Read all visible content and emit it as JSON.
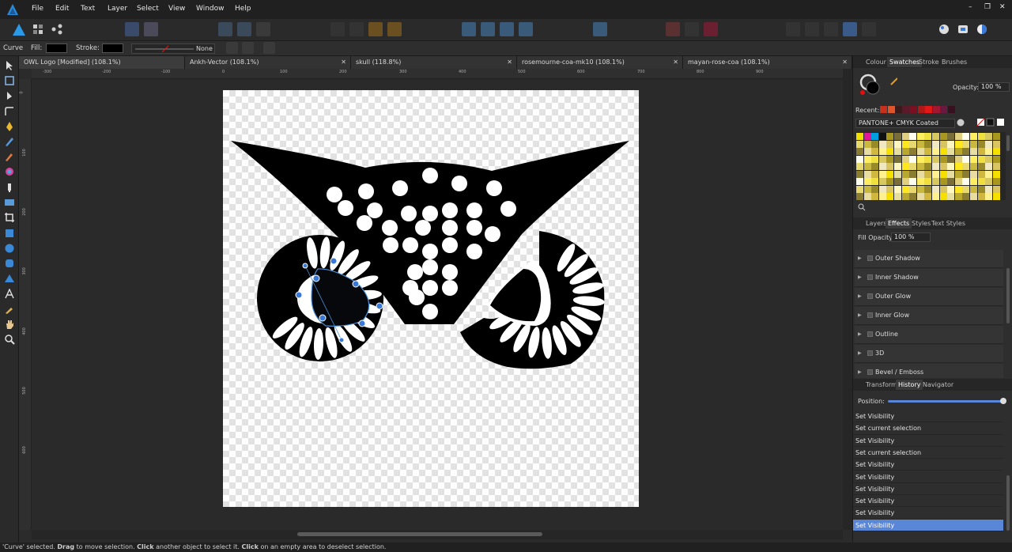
{
  "menu": [
    "File",
    "Edit",
    "Text",
    "Layer",
    "Select",
    "View",
    "Window",
    "Help"
  ],
  "window_controls": {
    "minimize": "–",
    "restore": "❐",
    "close": "✕"
  },
  "context": {
    "tool": "Curve",
    "fill_label": "Fill:",
    "stroke_label": "Stroke:",
    "stroke_style": "None",
    "fill_color": "#000000",
    "stroke_color": "#000000"
  },
  "tabs": [
    {
      "label": "OWL Logo [Modified] (108.1%)",
      "close": "✕"
    },
    {
      "label": "Ankh-Vector (108.1%)",
      "close": "✕"
    },
    {
      "label": "skull (118.8%)",
      "close": "✕"
    },
    {
      "label": "rosemourne-coa-mk10 (108.1%)",
      "close": "✕"
    },
    {
      "label": "mayan-rose-coa (108.1%)",
      "close": "✕"
    }
  ],
  "ruler_top": [
    "-300",
    "-200",
    "-100",
    "0",
    "100",
    "200",
    "300",
    "400",
    "500",
    "600",
    "700",
    "800",
    "900"
  ],
  "ruler_left": [
    "0",
    "100",
    "200",
    "300",
    "400",
    "500",
    "600"
  ],
  "color_panel": {
    "tabs": [
      "Colour",
      "Swatches",
      "Stroke",
      "Brushes"
    ],
    "opacity_label": "Opacity:",
    "opacity_value": "100 %",
    "recent_label": "Recent:",
    "palette": "PANTONE+ CMYK Coated",
    "recent_colors": [
      "#c8301e",
      "#e0542a",
      "#3a1a1a",
      "#5a1a2a",
      "#7a1020",
      "#b01818",
      "#e01818",
      "#a01830",
      "#6a1a40",
      "#3a1020"
    ],
    "swatch_colors": [
      "#f0e000",
      "#e0189a",
      "#00a0e0",
      "#101010",
      "#fffff0",
      "#fff6c0",
      "#fff090",
      "#ffee60",
      "#ffe820",
      "#f6e000",
      "#efe040",
      "#e8d870",
      "#e6dda0",
      "#d8c860",
      "#c8b840",
      "#b8a830",
      "#a89820",
      "#988a28",
      "#8a7c30",
      "#7a6e38",
      "#f0e8c0",
      "#e8dca0",
      "#e0d080",
      "#d8c460",
      "#d0b840"
    ],
    "active_fill": "#000000",
    "accent": "#e81010"
  },
  "effects_panel": {
    "tabs": [
      "Layers",
      "Effects",
      "Styles",
      "Text Styles"
    ],
    "fill_opacity_label": "Fill Opacity:",
    "fill_opacity_value": "100 %",
    "items": [
      "Outer Shadow",
      "Inner Shadow",
      "Outer Glow",
      "Inner Glow",
      "Outline",
      "3D",
      "Bevel / Emboss"
    ]
  },
  "history_panel": {
    "tabs": [
      "Transform",
      "History",
      "Navigator"
    ],
    "position_label": "Position:",
    "items": [
      "Set Visibility",
      "Set current selection",
      "Set Visibility",
      "Set current selection",
      "Set Visibility",
      "Set Visibility",
      "Set Visibility",
      "Set Visibility",
      "Set Visibility",
      "Set Visibility"
    ]
  },
  "status": {
    "prefix": "'Curve' selected. ",
    "drag": "Drag",
    "t1": " to move selection. ",
    "click1": "Click",
    "t2": " another object to select it. ",
    "click2": "Click",
    "t3": " on an empty area to deselect selection."
  },
  "colors": {
    "accent": "#5a86d8",
    "selection": "#3a78d8",
    "artwork": "#000000"
  }
}
